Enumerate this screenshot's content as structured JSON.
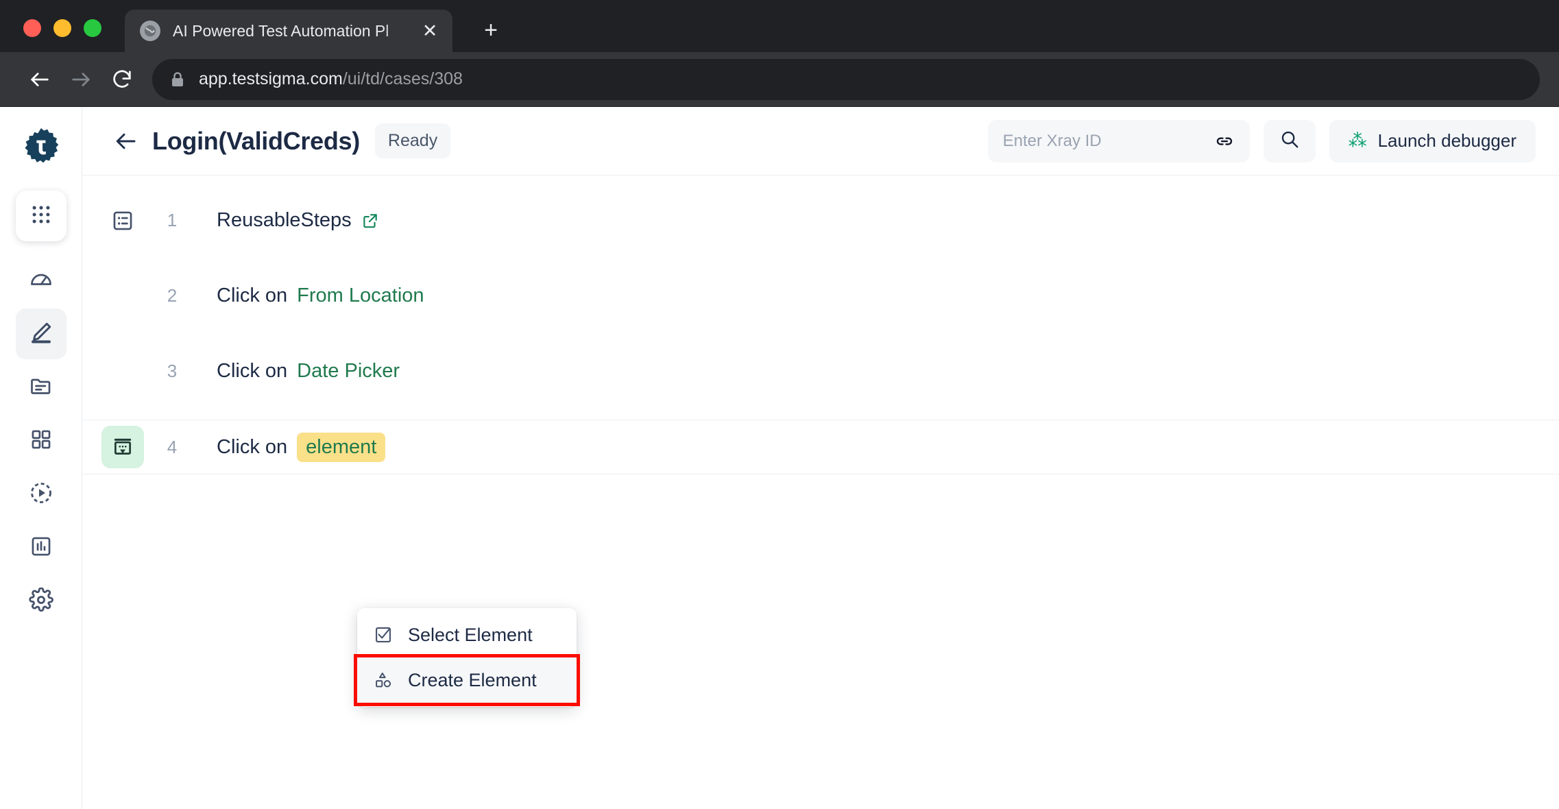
{
  "browser": {
    "tab": {
      "title": "AI Powered Test Automation Pl",
      "favicon_name": "globe-icon",
      "close_label": "✕"
    },
    "new_tab_label": "+",
    "nav": {
      "back_name": "back-icon",
      "forward_name": "forward-icon",
      "reload_name": "reload-icon"
    },
    "address": {
      "lock_name": "lock-icon",
      "domain": "app.testsigma.com",
      "path": "/ui/td/cases/308"
    },
    "window_controls": [
      "close",
      "minimize",
      "maximize"
    ]
  },
  "sidebar": {
    "logo_name": "testsigma-logo",
    "items": [
      {
        "name": "apps-grid-icon",
        "label": "Apps",
        "active": false,
        "tile": true
      },
      {
        "name": "dashboard-gauge-icon",
        "label": "Dashboard",
        "active": false,
        "tile": false
      },
      {
        "name": "pencil-edit-icon",
        "label": "Test Development",
        "active": true,
        "tile": false
      },
      {
        "name": "folder-icon",
        "label": "Test Data",
        "active": false,
        "tile": false
      },
      {
        "name": "grid-squares-icon",
        "label": "Elements",
        "active": false,
        "tile": false
      },
      {
        "name": "play-circle-icon",
        "label": "Run",
        "active": false,
        "tile": false
      },
      {
        "name": "bar-chart-icon",
        "label": "Reports",
        "active": false,
        "tile": false
      },
      {
        "name": "gear-settings-icon",
        "label": "Settings",
        "active": false,
        "tile": false
      }
    ]
  },
  "header": {
    "back_label": "Back",
    "title": "Login(ValidCreds)",
    "status_badge": "Ready",
    "xray": {
      "placeholder": "Enter Xray ID",
      "value": "",
      "link_icon": "link-icon"
    },
    "search_icon": "search-icon",
    "debugger": {
      "label": "Launch debugger",
      "icon": "bug-icon",
      "icon_glyph": "⁂",
      "icon_color": "#0aa06e"
    }
  },
  "steps": [
    {
      "number": "1",
      "icon": "reusable-steps-icon",
      "icon_style": "plain",
      "action": "",
      "label": "ReusableSteps",
      "element": "",
      "element_style": "none",
      "external_link": true,
      "sep_top": false,
      "sep_bottom": false
    },
    {
      "number": "2",
      "icon": "",
      "icon_style": "none",
      "action": "Click on",
      "label": "",
      "element": "From Location",
      "element_style": "text",
      "external_link": false,
      "sep_top": false,
      "sep_bottom": false
    },
    {
      "number": "3",
      "icon": "",
      "icon_style": "none",
      "action": "Click on",
      "label": "",
      "element": "Date Picker",
      "element_style": "text",
      "external_link": false,
      "sep_top": false,
      "sep_bottom": false
    },
    {
      "number": "4",
      "icon": "select-dropdown-icon",
      "icon_style": "green",
      "action": "Click on",
      "label": "",
      "element": "element",
      "element_style": "chip",
      "external_link": false,
      "sep_top": true,
      "sep_bottom": true
    }
  ],
  "dropdown": {
    "items": [
      {
        "label": "Select Element",
        "icon": "checkbox-checked-icon",
        "highlighted": false
      },
      {
        "label": "Create Element",
        "icon": "shapes-icon",
        "highlighted": true
      }
    ],
    "highlight_color": "#fb0d00"
  },
  "colors": {
    "chip_bg": "#fbe08a",
    "element_green": "#1f7a4d",
    "title_navy": "#1d2a44",
    "green_icon_bg": "#d6f2e0",
    "chrome_dark": "#202124",
    "chrome_toolbar": "#35363a"
  }
}
